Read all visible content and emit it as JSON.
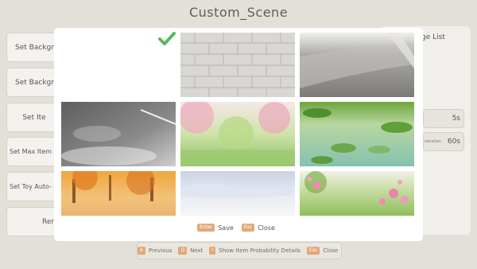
{
  "header": {
    "title": "Custom_Scene"
  },
  "sidebar": {
    "buttons": [
      {
        "label": "Set Backgro"
      },
      {
        "label": "Set Backgro"
      },
      {
        "label": "Set Ite"
      },
      {
        "label": "Set Max Item"
      },
      {
        "label": "Set Toy Auto-"
      },
      {
        "label": "Ren"
      }
    ]
  },
  "right_panel": {
    "label": "ge List",
    "rows": [
      {
        "value": "5s",
        "small": ""
      },
      {
        "value": "60s",
        "small": "neration"
      }
    ]
  },
  "background_bar": {
    "items": [
      {
        "key": "A",
        "text": "Previous"
      },
      {
        "key": "D",
        "text": "Next"
      },
      {
        "key": "I",
        "text": "Show Item Probability Details"
      },
      {
        "key": "Esc",
        "text": "Close"
      }
    ]
  },
  "modal": {
    "tiles": [
      {
        "name": "blank",
        "selected": true
      },
      {
        "name": "brick-wall"
      },
      {
        "name": "concrete-road"
      },
      {
        "name": "wet-asphalt"
      },
      {
        "name": "spring-forest"
      },
      {
        "name": "lily-pond"
      },
      {
        "name": "autumn-forest"
      },
      {
        "name": "snow-field"
      },
      {
        "name": "flower-meadow"
      }
    ],
    "footer": {
      "save_key": "Enter",
      "save_label": "Save",
      "close_key": "Esc",
      "close_label": "Close"
    }
  },
  "colors": {
    "accent": "#e0a97a",
    "check": "#5cb85c"
  }
}
